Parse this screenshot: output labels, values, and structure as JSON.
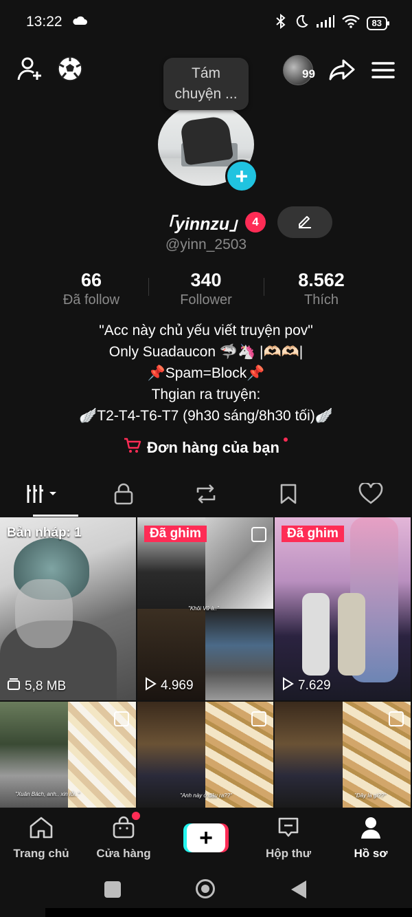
{
  "status_bar": {
    "time": "13:22",
    "battery": "83",
    "icons": [
      "cloud-icon",
      "bluetooth-icon",
      "moon-icon",
      "signal-icon",
      "wifi-icon",
      "battery-icon"
    ]
  },
  "header": {
    "story_count": "99",
    "tooltip_line1": "Tám",
    "tooltip_line2": "chuyện ..."
  },
  "profile": {
    "display_name": "「yinnzu」",
    "notification_count": "4",
    "username": "@yinn_2503"
  },
  "stats": [
    {
      "value": "66",
      "label": "Đã follow"
    },
    {
      "value": "340",
      "label": "Follower"
    },
    {
      "value": "8.562",
      "label": "Thích"
    }
  ],
  "bio": [
    "\"Acc này chủ yếu viết truyện pov\"",
    "Only Suadaucon 🦈🦄 |🫶🏻🫶🏻|",
    "📌Spam=Block📌",
    "Thgian ra truyện:",
    "🪽T2-T4-T6-T7 (9h30 sáng/8h30 tối)🪽"
  ],
  "orders": {
    "label": "Đơn hàng của bạn"
  },
  "grid": {
    "draft_label": "Bản nháp: 1",
    "draft_size": "5,8 MB",
    "pinned_label": "Đã ghim",
    "video2_views": "4.969",
    "video3_views": "7.629",
    "captions": [
      "\"Khôi Vũ à..\"",
      "\"Xuân Bách, anh.. xin lỗi..\"",
      "\"Anh này ở đâu ra??\"",
      "\"Đây là gì??\""
    ]
  },
  "bottom_nav": [
    {
      "label": "Trang chủ"
    },
    {
      "label": "Cửa hàng"
    },
    {
      "label": ""
    },
    {
      "label": "Hộp thư"
    },
    {
      "label": "Hồ sơ"
    }
  ],
  "colors": {
    "accent": "#fe2c55",
    "cyan": "#20c3e0",
    "background": "#121212"
  }
}
